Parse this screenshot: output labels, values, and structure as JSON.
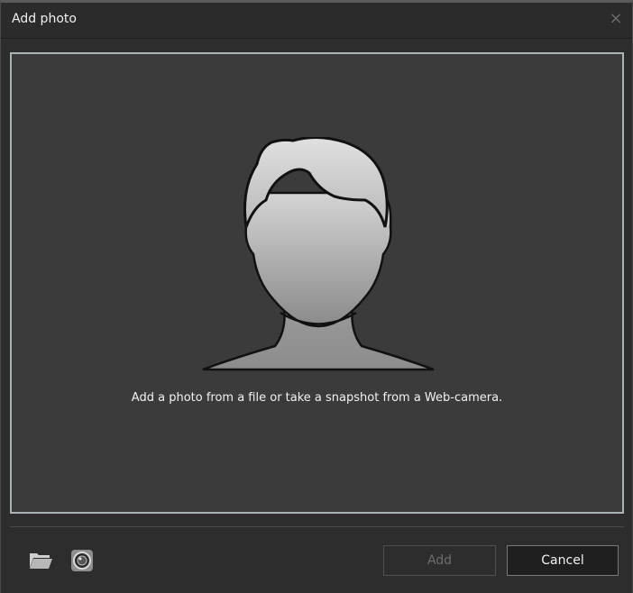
{
  "dialog": {
    "title": "Add photo",
    "close_glyph": "×"
  },
  "photo_area": {
    "placeholder_icon": "person-silhouette-icon",
    "hint": "Add a photo from a file or take a snapshot from a Web-camera."
  },
  "toolbar": {
    "open_file_icon": "folder-icon",
    "webcam_icon": "camera-icon"
  },
  "buttons": {
    "add_label": "Add",
    "add_enabled": false,
    "cancel_label": "Cancel"
  },
  "colors": {
    "background": "#2d2d2d",
    "photo_area": "#3b3b3b",
    "photo_area_border": "#a8b4b8"
  }
}
